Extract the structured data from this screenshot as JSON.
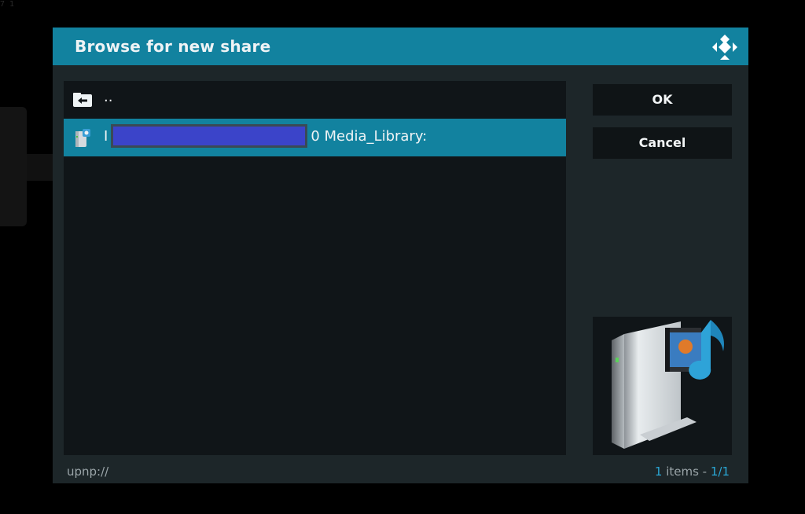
{
  "dialog": {
    "title": "Browse for new share"
  },
  "list": {
    "items": [
      {
        "label": "..",
        "icon": "folder-back-icon"
      },
      {
        "label_prefix": "I",
        "label_suffix": "0 Media_Library:",
        "icon": "upnp-server-icon",
        "selected": true,
        "redacted": true
      }
    ]
  },
  "buttons": {
    "ok_label": "OK",
    "cancel_label": "Cancel"
  },
  "footer": {
    "path": "upnp://",
    "count": "1",
    "count_text": " items - ",
    "page": "1/1"
  },
  "colors": {
    "accent": "#12829f",
    "page_indicator": "#2aa6d4",
    "redaction": "#3b44c9"
  }
}
